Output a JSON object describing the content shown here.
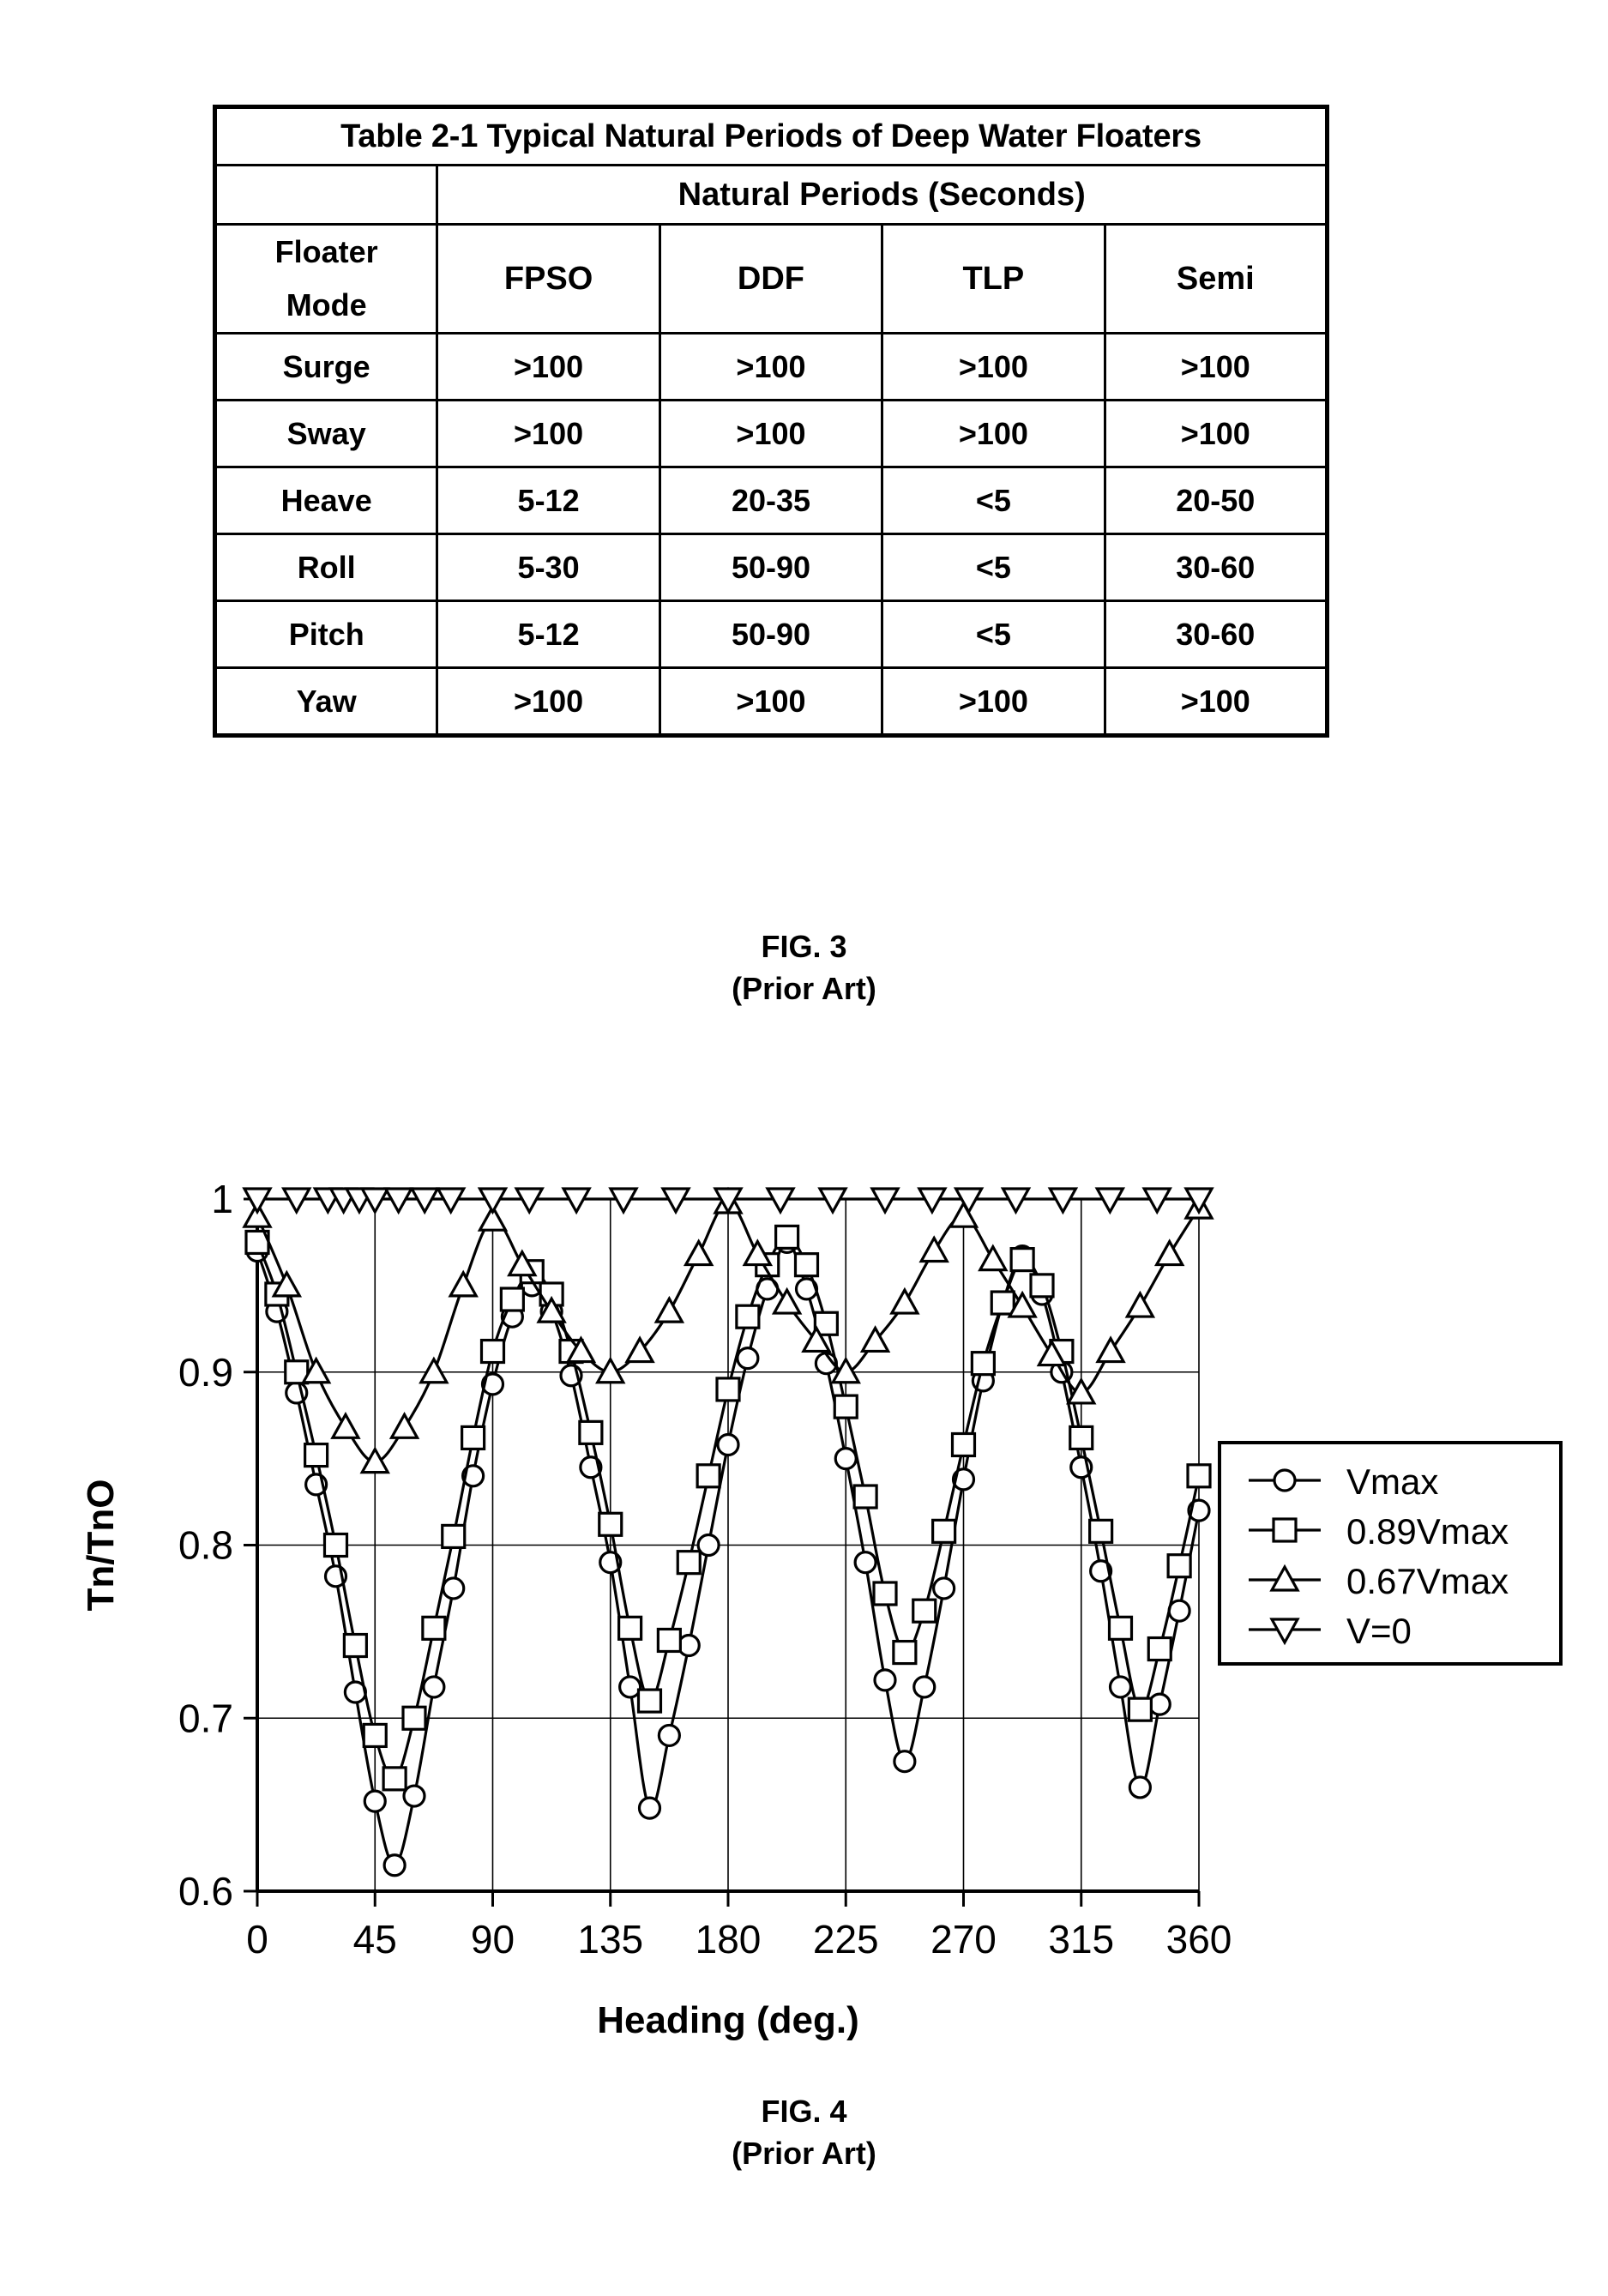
{
  "figures": {
    "fig3": {
      "caption_line1": "FIG. 3",
      "caption_line2": "(Prior Art)"
    },
    "fig4": {
      "caption_line1": "FIG. 4",
      "caption_line2": "(Prior Art)"
    }
  },
  "table": {
    "title": "Table 2-1 Typical Natural Periods of Deep Water Floaters",
    "group_header": "Natural Periods (Seconds)",
    "corner_label_top": "Floater",
    "corner_label_bottom": "Mode",
    "columns": [
      "FPSO",
      "DDF",
      "TLP",
      "Semi"
    ],
    "rows": [
      {
        "mode": "Surge",
        "values": [
          ">100",
          ">100",
          ">100",
          ">100"
        ]
      },
      {
        "mode": "Sway",
        "values": [
          ">100",
          ">100",
          ">100",
          ">100"
        ]
      },
      {
        "mode": "Heave",
        "values": [
          "5-12",
          "20-35",
          "<5",
          "20-50"
        ]
      },
      {
        "mode": "Roll",
        "values": [
          "5-30",
          "50-90",
          "<5",
          "30-60"
        ]
      },
      {
        "mode": "Pitch",
        "values": [
          "5-12",
          "50-90",
          "<5",
          "30-60"
        ]
      },
      {
        "mode": "Yaw",
        "values": [
          ">100",
          ">100",
          ">100",
          ">100"
        ]
      }
    ]
  },
  "chart_data": {
    "type": "line",
    "title": "",
    "xlabel": "Heading (deg.)",
    "ylabel": "Tn/TnO",
    "xlim": [
      0,
      360
    ],
    "ylim": [
      0.6,
      1.0
    ],
    "xticks": [
      0,
      45,
      90,
      135,
      180,
      225,
      270,
      315,
      360
    ],
    "yticks": [
      0.6,
      0.7,
      0.8,
      0.9,
      1
    ],
    "xtick_labels": [
      "0",
      "45",
      "90",
      "135",
      "180",
      "225",
      "270",
      "315",
      "360"
    ],
    "ytick_labels": [
      "0.6",
      "0.7",
      "0.8",
      "0.9",
      "1"
    ],
    "grid": true,
    "legend_position": "right",
    "series": [
      {
        "name": "Vmax",
        "marker": "circle",
        "x": [
          0,
          7.5,
          15,
          22.5,
          30,
          37.5,
          45,
          52.5,
          60,
          67.5,
          75,
          82.5,
          90,
          97.5,
          105,
          112.5,
          120,
          127.5,
          135,
          142.5,
          150,
          157.5,
          165,
          172.5,
          180,
          187.5,
          195,
          202.5,
          210,
          217.5,
          225,
          232.5,
          240,
          247.5,
          255,
          262.5,
          270,
          277.5,
          285,
          292.5,
          300,
          307.5,
          315,
          322.5,
          330,
          337.5,
          345,
          352.5,
          360
        ],
        "y": [
          0.97,
          0.935,
          0.888,
          0.835,
          0.782,
          0.715,
          0.652,
          0.615,
          0.655,
          0.718,
          0.775,
          0.84,
          0.893,
          0.932,
          0.95,
          0.935,
          0.898,
          0.845,
          0.79,
          0.718,
          0.648,
          0.69,
          0.742,
          0.8,
          0.858,
          0.908,
          0.948,
          0.975,
          0.948,
          0.905,
          0.85,
          0.79,
          0.722,
          0.675,
          0.718,
          0.775,
          0.838,
          0.895,
          0.94,
          0.967,
          0.945,
          0.9,
          0.845,
          0.785,
          0.718,
          0.66,
          0.708,
          0.762,
          0.82,
          0.882,
          0.935,
          0.968
        ]
      },
      {
        "name": "0.89Vmax",
        "marker": "square",
        "x": [
          0,
          7.5,
          15,
          22.5,
          30,
          37.5,
          45,
          52.5,
          60,
          67.5,
          75,
          82.5,
          90,
          97.5,
          105,
          112.5,
          120,
          127.5,
          135,
          142.5,
          150,
          157.5,
          165,
          172.5,
          180,
          187.5,
          195,
          202.5,
          210,
          217.5,
          225,
          232.5,
          240,
          247.5,
          255,
          262.5,
          270,
          277.5,
          285,
          292.5,
          300,
          307.5,
          315,
          322.5,
          330,
          337.5,
          345,
          352.5,
          360
        ],
        "y": [
          0.975,
          0.945,
          0.9,
          0.852,
          0.8,
          0.742,
          0.69,
          0.665,
          0.7,
          0.752,
          0.805,
          0.862,
          0.912,
          0.942,
          0.958,
          0.945,
          0.912,
          0.865,
          0.812,
          0.752,
          0.71,
          0.745,
          0.79,
          0.84,
          0.89,
          0.932,
          0.962,
          0.978,
          0.962,
          0.928,
          0.88,
          0.828,
          0.772,
          0.738,
          0.762,
          0.808,
          0.858,
          0.905,
          0.94,
          0.965,
          0.95,
          0.912,
          0.862,
          0.808,
          0.752,
          0.705,
          0.74,
          0.788,
          0.84,
          0.895,
          0.94,
          0.975
        ]
      },
      {
        "name": "0.67Vmax",
        "marker": "triangle-up",
        "x": [
          0,
          11.25,
          22.5,
          33.75,
          45,
          56.25,
          67.5,
          78.75,
          90,
          101.25,
          112.5,
          123.75,
          135,
          146.25,
          157.5,
          168.75,
          180,
          191.25,
          202.5,
          213.75,
          225,
          236.25,
          247.5,
          258.75,
          270,
          281.25,
          292.5,
          303.75,
          315,
          326.25,
          337.5,
          348.75,
          360
        ],
        "y": [
          0.99,
          0.95,
          0.9,
          0.868,
          0.848,
          0.868,
          0.9,
          0.95,
          0.988,
          0.962,
          0.935,
          0.912,
          0.9,
          0.912,
          0.935,
          0.968,
          0.998,
          0.968,
          0.94,
          0.918,
          0.9,
          0.918,
          0.94,
          0.97,
          0.99,
          0.965,
          0.938,
          0.91,
          0.888,
          0.912,
          0.938,
          0.968,
          0.995
        ]
      },
      {
        "name": "V=0",
        "marker": "triangle-down",
        "x": [
          0,
          15,
          27,
          33,
          39,
          45,
          54,
          64,
          74,
          90,
          104,
          122,
          140,
          160,
          180,
          200,
          220,
          240,
          258,
          272,
          290,
          308,
          326,
          344,
          360
        ],
        "y": [
          1.0,
          1.0,
          1.0,
          1.0,
          1.0,
          1.0,
          1.0,
          1.0,
          1.0,
          1.0,
          1.0,
          1.0,
          1.0,
          1.0,
          1.0,
          1.0,
          1.0,
          1.0,
          1.0,
          1.0,
          1.0,
          1.0,
          1.0,
          1.0,
          1.0
        ]
      }
    ]
  }
}
